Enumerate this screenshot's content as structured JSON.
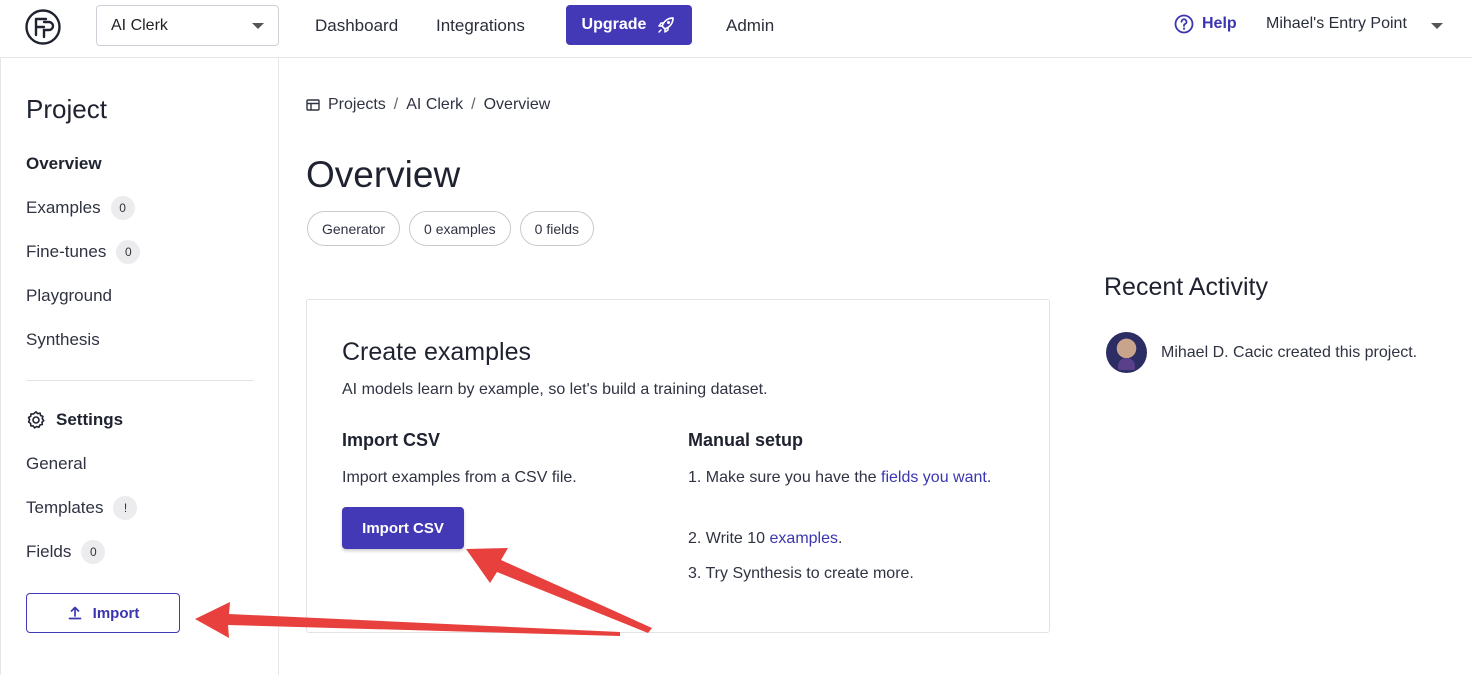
{
  "topbar": {
    "project_selected": "AI Clerk",
    "nav": [
      "Dashboard",
      "Integrations"
    ],
    "upgrade_label": "Upgrade",
    "admin_label": "Admin",
    "help_label": "Help",
    "account_label": "Mihael's Entry Point"
  },
  "sidebar": {
    "title": "Project",
    "items": [
      {
        "label": "Overview",
        "badge": ""
      },
      {
        "label": "Examples",
        "badge": "0"
      },
      {
        "label": "Fine-tunes",
        "badge": "0"
      },
      {
        "label": "Playground",
        "badge": ""
      },
      {
        "label": "Synthesis",
        "badge": ""
      }
    ],
    "settings_label": "Settings",
    "settings_items": [
      {
        "label": "General",
        "badge": ""
      },
      {
        "label": "Templates",
        "badge": "!"
      },
      {
        "label": "Fields",
        "badge": "0"
      }
    ],
    "import_label": "Import"
  },
  "breadcrumb": [
    "Projects",
    "AI Clerk",
    "Overview"
  ],
  "page_title": "Overview",
  "pills": [
    "Generator",
    "0 examples",
    "0 fields"
  ],
  "card": {
    "title": "Create examples",
    "subtitle": "AI models learn by example, so let's build a training dataset.",
    "import": {
      "title": "Import CSV",
      "text": "Import examples from a CSV file.",
      "button": "Import CSV"
    },
    "manual": {
      "title": "Manual setup",
      "step1_pre": "1. Make sure you have the ",
      "step1_link": "fields you want",
      "step1_post": ".",
      "step2_pre": "2. Write 10 ",
      "step2_link": "examples",
      "step2_post": ".",
      "step3": "3. Try Synthesis to create more."
    }
  },
  "recent": {
    "title": "Recent Activity",
    "entry": "Mihael D. Cacic created this project."
  },
  "colors": {
    "accent": "#4338b5",
    "annotation_arrow": "#e8403c"
  }
}
